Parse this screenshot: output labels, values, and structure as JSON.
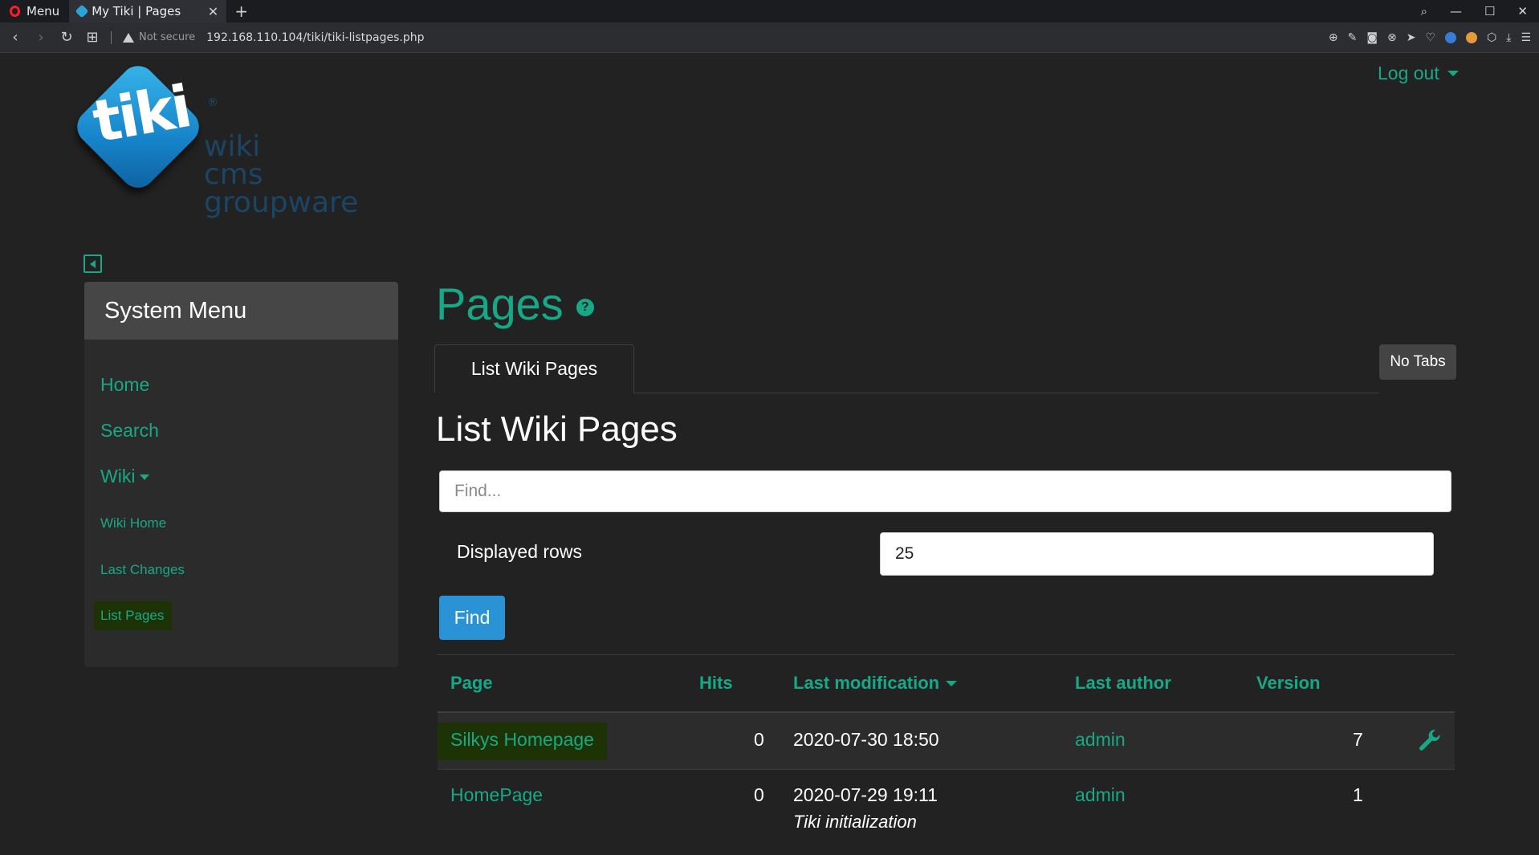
{
  "browser": {
    "menu_label": "Menu",
    "tab_title": "My Tiki | Pages",
    "security": "Not secure",
    "url": "192.168.110.104/tiki/tiki-listpages.php"
  },
  "header": {
    "logout_label": "Log out",
    "logo_text": "tiki",
    "logo_tagline": [
      "wiki",
      "cms",
      "groupware"
    ]
  },
  "sidebar": {
    "title": "System Menu",
    "items": [
      {
        "label": "Home"
      },
      {
        "label": "Search"
      },
      {
        "label": "Wiki"
      },
      {
        "label": "Wiki Home"
      },
      {
        "label": "Last Changes"
      },
      {
        "label": "List Pages"
      }
    ]
  },
  "main": {
    "title": "Pages",
    "tab_label": "List Wiki Pages",
    "no_tabs_label": "No Tabs",
    "section_title": "List Wiki Pages",
    "find_placeholder": "Find...",
    "rows_label": "Displayed rows",
    "rows_value": "25",
    "find_button": "Find"
  },
  "table": {
    "headers": [
      "Page",
      "Hits",
      "Last modification",
      "Last author",
      "Version"
    ],
    "rows": [
      {
        "page": "Silkys Homepage",
        "hits": "0",
        "modified": "2020-07-30 18:50",
        "comment": "",
        "author": "admin",
        "version": "7"
      },
      {
        "page": "HomePage",
        "hits": "0",
        "modified": "2020-07-29 19:11",
        "comment": "Tiki initialization",
        "author": "admin",
        "version": "1"
      }
    ]
  },
  "colors": {
    "accent": "#17a987",
    "button": "#2a93d5",
    "highlight": "#1d3305",
    "background": "#222222"
  }
}
